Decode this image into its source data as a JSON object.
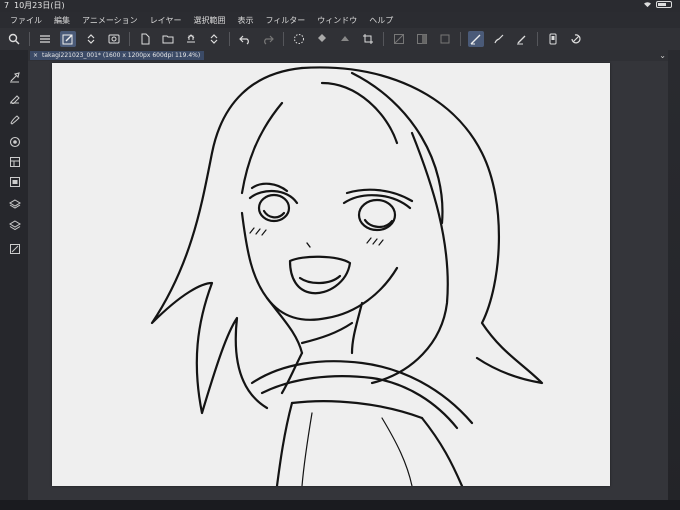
{
  "status_bar": {
    "time": "7",
    "date": "10月23日(日)"
  },
  "menu": [
    "ファイル",
    "編集",
    "アニメーション",
    "レイヤー",
    "選択範囲",
    "表示",
    "フィルター",
    "ウィンドウ",
    "ヘルプ"
  ],
  "document_tab": {
    "title": "takagi221023_001* (1600 x 1200px 600dpi 119.4%)",
    "close_glyph": "×"
  },
  "icons": {
    "menu": "hamburger-menu-icon",
    "pen": "pen-edit-icon",
    "canvas_view": "canvas-view-icon",
    "new": "new-file-icon",
    "open": "open-folder-icon",
    "save": "save-icon",
    "undo": "undo-icon",
    "redo": "redo-icon",
    "selection": "selection-icon",
    "fill": "fill-icon",
    "crop": "crop-icon",
    "line_correction": "line-correction-icon",
    "smart": "smart-icon",
    "panel_toggle": "chevron-down-icon"
  },
  "colors": {
    "menubar_bg": "#2b2c31",
    "toolbar_bg": "#303136",
    "active_tool": "#4a5a78",
    "canvas_bg": "#efefef",
    "line_art": "#141414"
  }
}
